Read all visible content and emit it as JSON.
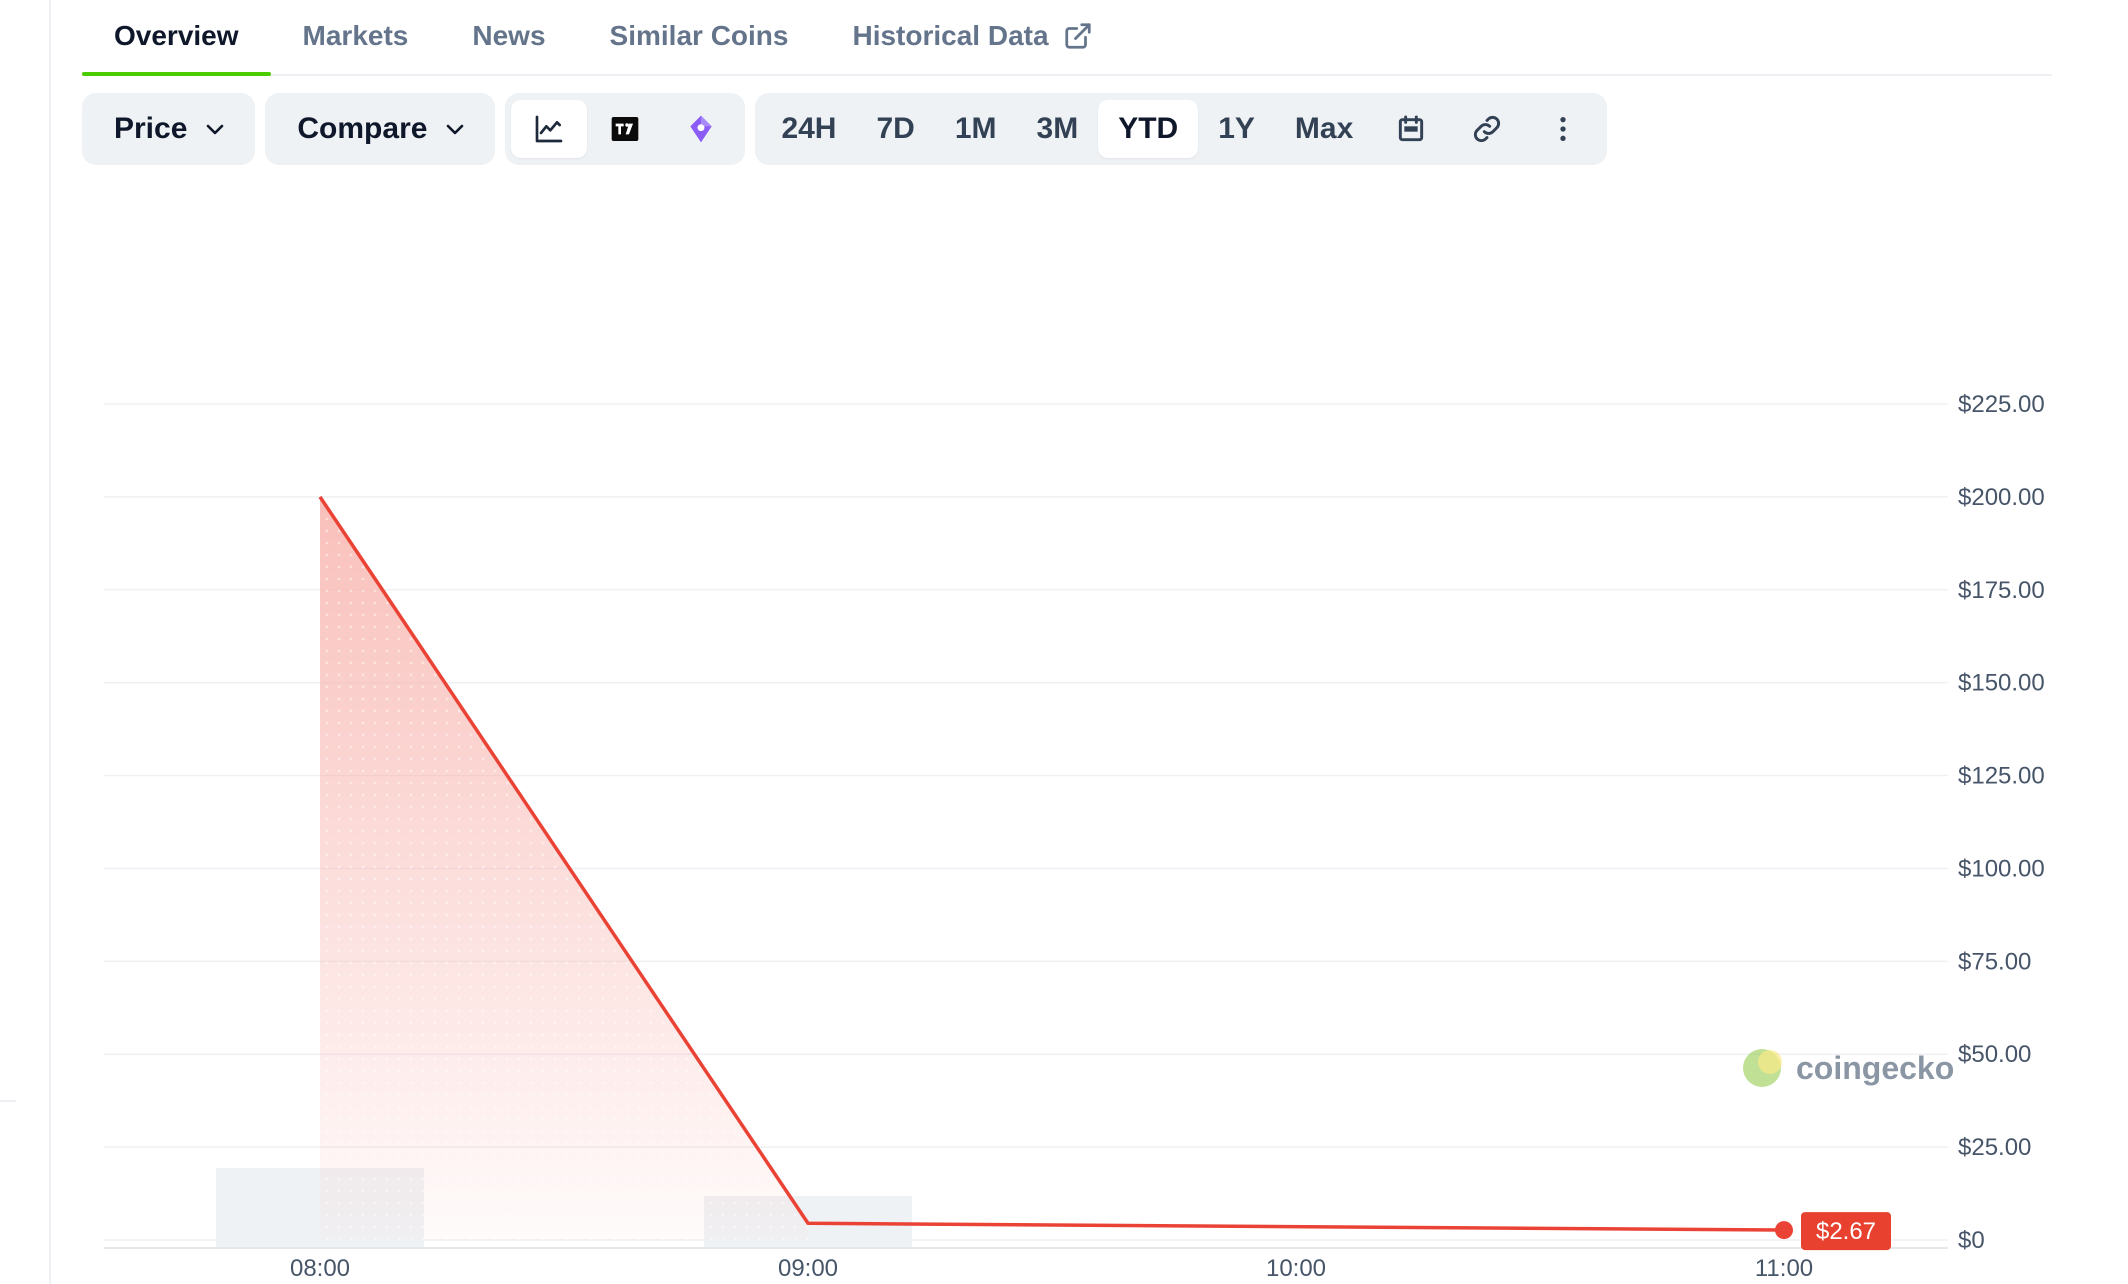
{
  "tabs": [
    {
      "label": "Overview",
      "active": true
    },
    {
      "label": "Markets",
      "active": false
    },
    {
      "label": "News",
      "active": false
    },
    {
      "label": "Similar Coins",
      "active": false
    },
    {
      "label": "Historical Data",
      "active": false,
      "icon": "external-link-icon"
    }
  ],
  "toolbar": {
    "price_label": "Price",
    "compare_label": "Compare",
    "chart_types": [
      {
        "icon": "line-chart-icon",
        "selected": true
      },
      {
        "icon": "tradingview-icon",
        "selected": false
      },
      {
        "icon": "ai-chart-icon",
        "selected": false
      }
    ],
    "ranges": [
      "24H",
      "7D",
      "1M",
      "3M",
      "YTD",
      "1Y",
      "Max"
    ],
    "selected_range": "YTD",
    "extra_icons": [
      "calendar-icon",
      "link-icon",
      "more-vertical-icon"
    ]
  },
  "colors": {
    "line": "#ea4335",
    "fill": "#f8b4ae",
    "active_tab_underline": "#4bcc00",
    "volume_bar": "#eff2f5",
    "badge": "#e8412f"
  },
  "watermark": "coingecko",
  "chart_data": {
    "type": "area",
    "x": [
      "08:00",
      "09:00",
      "11:00"
    ],
    "values": [
      200,
      4.5,
      2.67
    ],
    "x_ticks": [
      "08:00",
      "09:00",
      "10:00",
      "11:00"
    ],
    "y_ticks": [
      "$225.00",
      "$200.00",
      "$175.00",
      "$150.00",
      "$125.00",
      "$100.00",
      "$75.00",
      "$50.00",
      "$25.00",
      "$0"
    ],
    "ylim": [
      0,
      225
    ],
    "last_price_label": "$2.67",
    "volume": [
      {
        "x": "08:00",
        "value": 1.0
      },
      {
        "x": "09:00",
        "value": 0.65
      }
    ],
    "grid": true
  }
}
